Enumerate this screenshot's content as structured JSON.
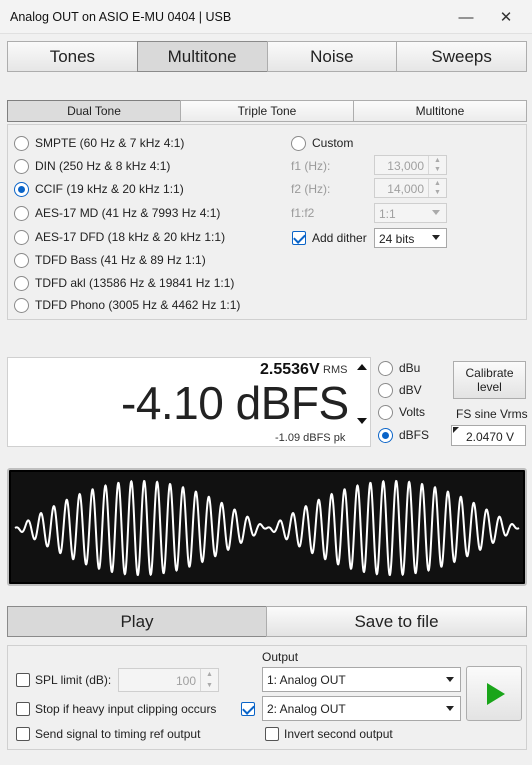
{
  "window": {
    "title": "Analog OUT on ASIO E-MU 0404 | USB",
    "minimize": "—",
    "close": "✕"
  },
  "tabs": [
    {
      "label": "Tones"
    },
    {
      "label": "Multitone"
    },
    {
      "label": "Noise"
    },
    {
      "label": "Sweeps"
    }
  ],
  "subtabs": [
    {
      "label": "Dual Tone"
    },
    {
      "label": "Triple Tone"
    },
    {
      "label": "Multitone"
    }
  ],
  "presets": [
    {
      "label": "SMPTE (60 Hz & 7 kHz 4:1)",
      "selected": false
    },
    {
      "label": "DIN (250 Hz & 8 kHz 4:1)",
      "selected": false
    },
    {
      "label": "CCIF (19 kHz & 20 kHz 1:1)",
      "selected": true
    },
    {
      "label": "AES-17 MD (41 Hz & 7993 Hz 4:1)",
      "selected": false
    },
    {
      "label": "AES-17 DFD (18 kHz & 20 kHz 1:1)",
      "selected": false
    },
    {
      "label": "TDFD Bass (41 Hz & 89 Hz 1:1)",
      "selected": false
    },
    {
      "label": "TDFD akl (13586 Hz & 19841 Hz 1:1)",
      "selected": false
    },
    {
      "label": "TDFD Phono (3005 Hz & 4462 Hz 1:1)",
      "selected": false
    }
  ],
  "custom": {
    "label": "Custom",
    "f1_label": "f1 (Hz):",
    "f1_value": "13,000",
    "f2_label": "f2 (Hz):",
    "f2_value": "14,000",
    "ratio_label": "f1:f2",
    "ratio_value": "1:1",
    "dither_label": "Add dither",
    "dither_checked": true,
    "dither_value": "24 bits"
  },
  "level": {
    "rms_value": "2.5536V",
    "rms_unit": "RMS",
    "main": "-4.10 dBFS",
    "peak": "-1.09 dBFS pk",
    "units": [
      {
        "label": "dBu",
        "selected": false
      },
      {
        "label": "dBV",
        "selected": false
      },
      {
        "label": "Volts",
        "selected": false
      },
      {
        "label": "dBFS",
        "selected": true
      }
    ],
    "calibrate_line1": "Calibrate",
    "calibrate_line2": "level",
    "fs_label": "FS sine Vrms",
    "fs_value": "2.0470 V"
  },
  "actions": {
    "play": "Play",
    "save": "Save to file"
  },
  "options": {
    "spl_label": "SPL limit (dB):",
    "spl_value": "100",
    "spl_checked": false,
    "stop_clip_label": "Stop if heavy input clipping occurs",
    "stop_clip_checked": false,
    "timing_label": "Send signal to timing ref output",
    "timing_checked": false,
    "output_label": "Output",
    "output1": "1: Analog OUT",
    "output2": "2: Analog OUT",
    "output2_checked": true,
    "invert_label": "Invert second output",
    "invert_checked": false
  },
  "colors": {
    "accent": "#0a64c8",
    "play_icon": "#1aa51a",
    "scope_bg": "#000000",
    "waveform": "#ffffff"
  },
  "waveform": {
    "f1_cycles": 38,
    "f2_cycles": 40
  }
}
